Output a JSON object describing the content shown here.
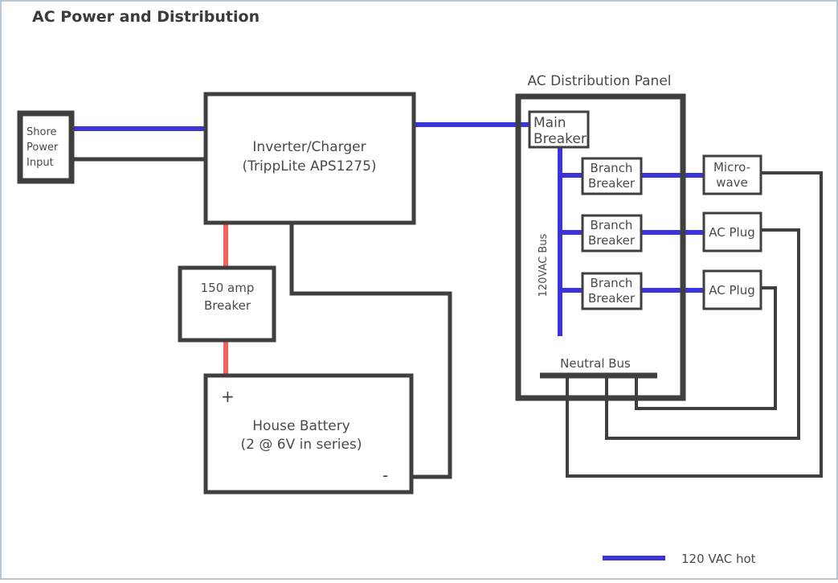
{
  "page": {
    "title": "AC Power and Distribution",
    "background_color": "#ffffff",
    "border_color": "#b8c6d1"
  },
  "colors": {
    "hot_wire": "#3b34d6",
    "dc_positive_wire": "#f4625e",
    "neutral_wire": "#3f3f3f",
    "box_stroke": "#3f3f3f",
    "text": "#4a4a4a"
  },
  "nodes": {
    "shore_power": {
      "label_line1": "Shore",
      "label_line2": "Power",
      "label_line3": "Input"
    },
    "inverter": {
      "label_line1": "Inverter/Charger",
      "label_line2": "(TrippLite APS1275)"
    },
    "dc_breaker": {
      "label_line1": "150 amp",
      "label_line2": "Breaker"
    },
    "battery": {
      "label_line1": "House Battery",
      "label_line2": "(2 @ 6V in series)",
      "positive_sign": "+",
      "negative_sign": "-"
    },
    "panel": {
      "title": "AC Distribution Panel",
      "main_breaker_line1": "Main",
      "main_breaker_line2": "Breaker",
      "bus_label": "120VAC Bus",
      "neutral_bus_label": "Neutral Bus",
      "branch_breakers": [
        {
          "line1": "Branch",
          "line2": "Breaker"
        },
        {
          "line1": "Branch",
          "line2": "Breaker"
        },
        {
          "line1": "Branch",
          "line2": "Breaker"
        }
      ]
    },
    "loads": [
      {
        "line1": "Micro-",
        "line2": "wave"
      },
      {
        "line1": "AC Plug",
        "line2": ""
      },
      {
        "line1": "AC Plug",
        "line2": ""
      }
    ]
  },
  "legend": {
    "items": [
      {
        "label": "120 VAC hot",
        "color": "#3b34d6"
      }
    ]
  }
}
